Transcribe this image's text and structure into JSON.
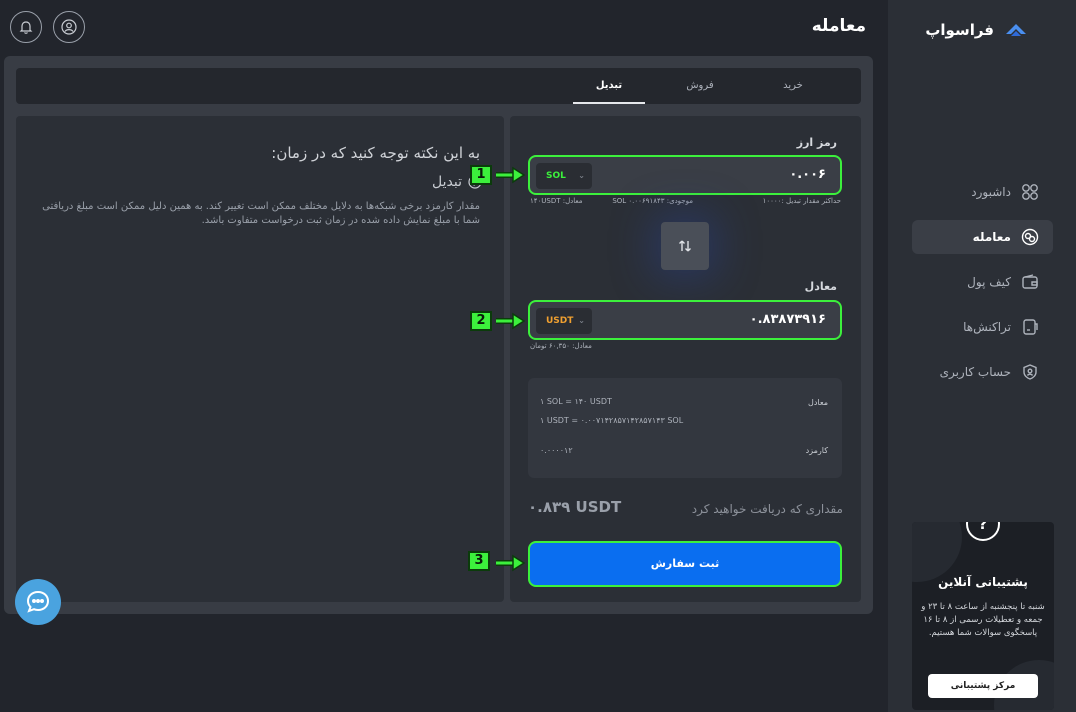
{
  "brand": {
    "name": "فراسواپ",
    "icon": "chevron-logo-icon"
  },
  "header": {
    "title": "معامله",
    "bell_icon": "bell-icon",
    "user_icon": "user-circle-icon"
  },
  "sidebar": {
    "items": [
      {
        "label": "داشبورد",
        "icon": "grid-icon"
      },
      {
        "label": "معامله",
        "icon": "exchange-icon"
      },
      {
        "label": "کیف پول",
        "icon": "wallet-icon"
      },
      {
        "label": "تراکنش‌ها",
        "icon": "receipt-icon"
      },
      {
        "label": "حساب کاربری",
        "icon": "shield-user-icon"
      }
    ],
    "support": {
      "badge": "?",
      "title": "پشتیبانی آنلاین",
      "text": "شنبه تا پنجشنبه از ساعت ۸ تا ۲۳ و جمعه و تعطیلات رسمی از ۸ تا ۱۶ پاسخگوی سوالات شما هستیم.",
      "button": "مرکز پشتیبانی"
    }
  },
  "tabs": [
    {
      "label": "خرید"
    },
    {
      "label": "فروش"
    },
    {
      "label": "تبدیل"
    }
  ],
  "info": {
    "title": "به این نکته توجه کنید که در زمان:",
    "subtitle": "تبدیل",
    "body": "مقدار کارمزد برخی شبکه‌ها به دلایل مختلف ممکن است تغییر کند. به همین دلیل ممکن است مبلغ دریافتی شما با مبلغ نمایش داده شده در زمان ثبت درخواست متفاوت باشد."
  },
  "trade": {
    "from_label": "رمز ارز",
    "from_coin": "SOL",
    "from_amount": "۰.۰۰۶",
    "max_label": "حداکثر مقدار تبدیل :۱۰۰۰۰",
    "balance_label": "موجودی: SOL ۰.۰۰۶۹۱۸۴۳",
    "equiv_label": "معادل: ۱۴۰USDT",
    "to_label": "معادل",
    "to_coin": "USDT",
    "to_amount": "۰.۸۳۸۷۳۹۱۶",
    "to_equiv": "معادل: ۶۰,۳۵۰ تومان",
    "summary": {
      "rate_label": "معادل",
      "rate_1": "۱ SOL = ۱۴۰ USDT",
      "rate_2": "۱ USDT = ۰.۰۰۷۱۴۲۸۵۷۱۴۲۸۵۷۱۴۳ SOL",
      "fee_label": "کارمزد",
      "fee_value": "۰.۰۰۰۰۱۲"
    },
    "receive_label": "مقداری که دریافت خواهید کرد",
    "receive_value": "۰.۸۳۹ USDT",
    "submit": "ثبت سفارش"
  },
  "markers": [
    "1",
    "2",
    "3"
  ],
  "colors": {
    "accent": "#0a6ef0",
    "highlight": "#3cf03c",
    "sol": "#3cf03c",
    "usdt": "#f0a030"
  }
}
